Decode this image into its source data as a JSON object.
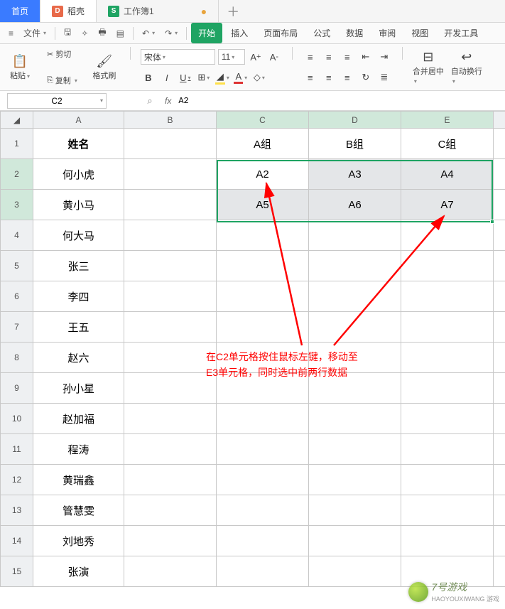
{
  "tabs": {
    "home": "首页",
    "docking_icon": "D",
    "docking_label": "稻壳",
    "sheet_icon": "S",
    "sheet_label": "工作簿1"
  },
  "menu": {
    "file": "文件",
    "start": "开始",
    "insert": "插入",
    "layout": "页面布局",
    "formula": "公式",
    "data": "数据",
    "review": "审阅",
    "view": "视图",
    "dev": "开发工具"
  },
  "ribbon": {
    "paste": "粘贴",
    "cut": "剪切",
    "copy": "复制",
    "format_painter": "格式刷",
    "font_name": "宋体",
    "font_size": "11",
    "merge_center": "合并居中",
    "auto_wrap": "自动换行"
  },
  "namebox": "C2",
  "fx": "A2",
  "columns": [
    "A",
    "B",
    "C",
    "D",
    "E"
  ],
  "rows": {
    "1": {
      "A": "姓名",
      "C": "A组",
      "D": "B组",
      "E": "C组"
    },
    "2": {
      "A": "何小虎",
      "C": "A2",
      "D": "A3",
      "E": "A4"
    },
    "3": {
      "A": "黄小马",
      "C": "A5",
      "D": "A6",
      "E": "A7"
    },
    "4": {
      "A": "何大马"
    },
    "5": {
      "A": "张三"
    },
    "6": {
      "A": "李四"
    },
    "7": {
      "A": "王五"
    },
    "8": {
      "A": "赵六"
    },
    "9": {
      "A": "孙小星"
    },
    "10": {
      "A": "赵加福"
    },
    "11": {
      "A": "程涛"
    },
    "12": {
      "A": "黄瑞鑫"
    },
    "13": {
      "A": "管慧雯"
    },
    "14": {
      "A": "刘地秀"
    },
    "15": {
      "A": "张演"
    }
  },
  "annotation": {
    "l1": "在C2单元格按住鼠标左键，移动至",
    "l2": "E3单元格，同时选中前两行数据"
  },
  "watermark": {
    "text": "7号游戏",
    "sub": "HAOYOUXIWANG 游戏"
  },
  "colors": {
    "primary_green": "#1fa463",
    "tab_blue": "#3a7bff",
    "annotation_red": "#f00"
  }
}
